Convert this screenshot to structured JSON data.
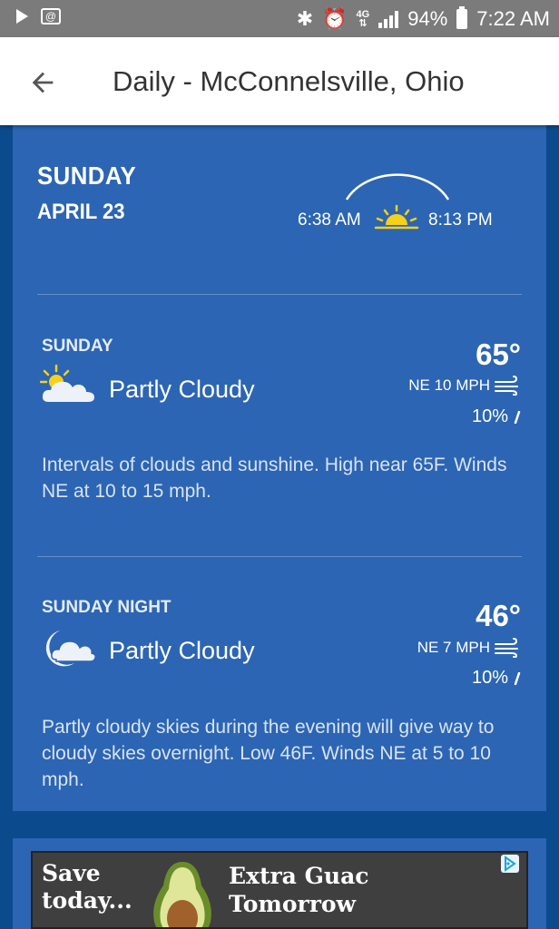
{
  "status_bar": {
    "battery": "94%",
    "time": "7:22 AM",
    "network": "4G"
  },
  "header": {
    "title": "Daily - McConnelsville, Ohio"
  },
  "day": {
    "name": "SUNDAY",
    "date": "APRIL 23",
    "sunrise": "6:38 AM",
    "sunset": "8:13 PM"
  },
  "periods": [
    {
      "label": "SUNDAY",
      "temp": "65°",
      "condition": "Partly Cloudy",
      "icon": "partly-cloudy-day-icon",
      "wind": "NE 10 MPH",
      "precip": "10%",
      "description": "Intervals of clouds and sunshine. High near 65F. Winds NE at 10 to 15 mph."
    },
    {
      "label": "SUNDAY NIGHT",
      "temp": "46°",
      "condition": "Partly Cloudy",
      "icon": "partly-cloudy-night-icon",
      "wind": "NE 7 MPH",
      "precip": "10%",
      "description": "Partly cloudy skies during the evening will give way to cloudy skies overnight. Low 46F. Winds NE at 5 to 10 mph."
    }
  ],
  "ad": {
    "left_text_line1": "Save",
    "left_text_line2": "today...",
    "right_text_line1": "Extra Guac",
    "right_text_line2": "Tomorrow"
  },
  "colors": {
    "background": "#0c4a8e",
    "card": "#2c65b3",
    "status_bar": "#7b7b7b",
    "sun": "#f7d117"
  }
}
